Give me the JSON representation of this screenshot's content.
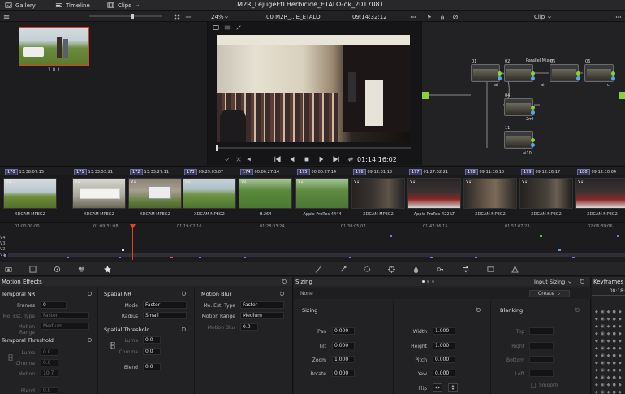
{
  "topbar": {
    "gallery": "Gallery",
    "timeline": "Timeline",
    "clips": "Clips",
    "project_title": "M2R_LejugeEtLHerbicide_ETALO-ok_20170811"
  },
  "viewerbar": {
    "zoom": "24%",
    "clip_name": "00 M2R_...E_ETALO",
    "timecode": "09:14:32:12",
    "node_mode": "Clip"
  },
  "mediapool": {
    "clip_label": "1.8.1"
  },
  "viewer": {
    "playback_timecode": "01:14:16:02"
  },
  "nodes": {
    "items": [
      {
        "label": "01"
      },
      {
        "label": "02"
      },
      {
        "label": "05"
      },
      {
        "label": "06"
      },
      {
        "label": "04"
      },
      {
        "label": "11"
      }
    ],
    "parallel_label": "Parallel Mixer",
    "captions": [
      "ai",
      "2ml",
      "ai",
      "cl",
      "ai10"
    ]
  },
  "clips": [
    {
      "num": "170",
      "tc": "13:38:07:15",
      "track": "V1",
      "codec": "XDCAM MPEG2",
      "thumb": "tree"
    },
    {
      "num": "171",
      "tc": "13:33:53:21",
      "track": "V1",
      "codec": "XDCAM MPEG2",
      "thumb": "roundup"
    },
    {
      "num": "172",
      "tc": "13:33:27:11",
      "track": "V1",
      "codec": "XDCAM MPEG2",
      "thumb": "sign"
    },
    {
      "num": "173",
      "tc": "09:29:03:07",
      "track": "V1",
      "codec": "XDCAM MPEG2",
      "thumb": "field"
    },
    {
      "num": "174",
      "tc": "00:00:27:14",
      "track": "V1",
      "codec": "H.264",
      "thumb": "aerial"
    },
    {
      "num": "175",
      "tc": "00:00:27:14",
      "track": "V1",
      "codec": "Apple ProRes 4444",
      "thumb": "aerial2"
    },
    {
      "num": "176",
      "tc": "09:12:01:13",
      "track": "V1",
      "codec": "XDCAM MPEG2",
      "thumb": "speaker"
    },
    {
      "num": "177",
      "tc": "01:27:02:21",
      "track": "V1",
      "codec": "Apple ProRes 422 LT",
      "thumb": "panel"
    },
    {
      "num": "178",
      "tc": "09:11:16:10",
      "track": "V1",
      "codec": "XDCAM MPEG2",
      "thumb": "speaker2"
    },
    {
      "num": "179",
      "tc": "09:12:26:17",
      "track": "V1",
      "codec": "XDCAM MPEG2",
      "thumb": "speaker3"
    },
    {
      "num": "180",
      "tc": "09:12:10:04",
      "track": "V1",
      "codec": "XDCAM MPEG2",
      "thumb": "panel2"
    }
  ],
  "timeline": {
    "ruler": [
      "01:00:00:00",
      "01:09:31:08",
      "01:19:02:16",
      "01:28:33:24",
      "01:38:05:07",
      "01:47:36:15",
      "01:57:07:23",
      "02:06:39:06"
    ],
    "tracks": [
      "V4",
      "V3",
      "V2",
      "V1"
    ]
  },
  "motion_effects": {
    "title": "Motion Effects",
    "temporal_nr": {
      "title": "Temporal NR",
      "frames_label": "Frames",
      "frames": "0",
      "mo_est_label": "Mo. Est. Type",
      "mo_est": "Faster",
      "motion_range_label": "Motion Range",
      "motion_range": "Medium"
    },
    "temporal_threshold": {
      "title": "Temporal Threshold",
      "luma_label": "Luma",
      "luma": "0.0",
      "chroma_label": "Chroma",
      "chroma": "0.0",
      "motion_label": "Motion",
      "motion": "10.7",
      "blend_label": "Blend",
      "blend": "0.0"
    },
    "spatial_nr": {
      "title": "Spatial NR",
      "mode_label": "Mode",
      "mode": "Faster",
      "radius_label": "Radius",
      "radius": "Small"
    },
    "spatial_threshold": {
      "title": "Spatial Threshold",
      "luma_label": "Luma",
      "luma": "0.0",
      "chroma_label": "Chroma",
      "chroma": "0.0",
      "blend_label": "Blend",
      "blend": "0.0"
    },
    "motion_blur": {
      "title": "Motion Blur",
      "mo_est_label": "Mo. Est. Type",
      "mo_est": "Faster",
      "motion_range_label": "Motion Range",
      "motion_range": "Medium",
      "motion_blur_label": "Motion Blur",
      "motion_blur": "0.0"
    }
  },
  "sizing": {
    "title": "Sizing",
    "mode": "Input Sizing",
    "preset": "None",
    "create_label": "Create",
    "section": "Sizing",
    "pan_label": "Pan",
    "pan": "0.000",
    "tilt_label": "Tilt",
    "tilt": "0.000",
    "zoom_label": "Zoom",
    "zoom": "1.000",
    "rotate_label": "Rotate",
    "rotate": "0.000",
    "width_label": "Width",
    "width": "1.000",
    "height_label": "Height",
    "height": "1.000",
    "pitch_label": "Pitch",
    "pitch": "0.000",
    "yaw_label": "Yaw",
    "yaw": "0.000",
    "flip_label": "Flip",
    "blanking": {
      "title": "Blanking",
      "top_label": "Top",
      "right_label": "Right",
      "bottom_label": "Bottom",
      "left_label": "Left",
      "smooth_label": "Smooth"
    }
  },
  "keyframes": {
    "title": "Keyframes",
    "timecode": "00:18:"
  }
}
